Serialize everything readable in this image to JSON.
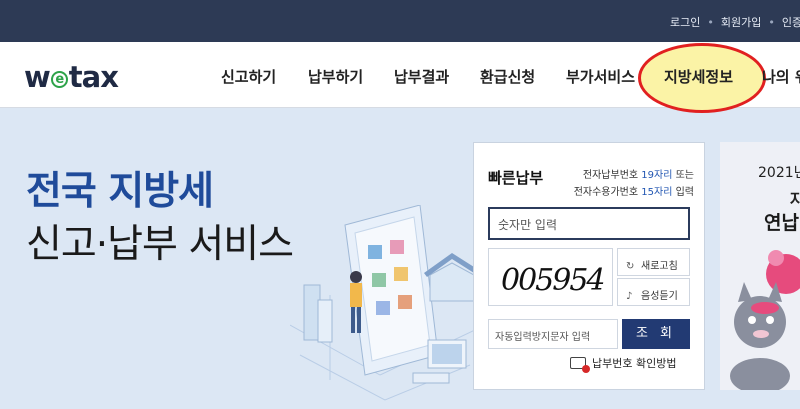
{
  "header": {
    "links": [
      "로그인",
      "회원가입",
      "인증"
    ]
  },
  "nav": {
    "logo": {
      "pre": "w",
      "mark": "e",
      "post": "tax"
    },
    "items": [
      "신고하기",
      "납부하기",
      "납부결과",
      "환급신청",
      "부가서비스",
      "지방세정보",
      "나의 위"
    ],
    "highlighted": "지방세정보",
    "highlight_color": "#e12020"
  },
  "hero": {
    "title": "전국 지방세",
    "subtitle": "신고·납부 서비스"
  },
  "quick_pay": {
    "title": "빠른납부",
    "help_line1_pre": "전자납부번호",
    "help_line1_num": "19자리",
    "help_line1_post": "또는",
    "help_line2_pre": "전자수용가번호",
    "help_line2_num": "15자리",
    "help_line2_post": "입력",
    "input_placeholder": "숫자만 입력",
    "captcha_text": "005954",
    "refresh_label": "새로고침",
    "audio_label": "음성듣기",
    "captcha_placeholder": "자동입력방지문자 입력",
    "submit_label": "조 회",
    "howto_label": "납부번호 확인방법"
  },
  "promo": {
    "year": "2021년",
    "line2": "자",
    "title": "연납"
  },
  "colors": {
    "topbar": "#2d3a55",
    "brand_blue": "#1f4b9a",
    "button": "#223a73",
    "page_bg": "#dce7f4"
  }
}
